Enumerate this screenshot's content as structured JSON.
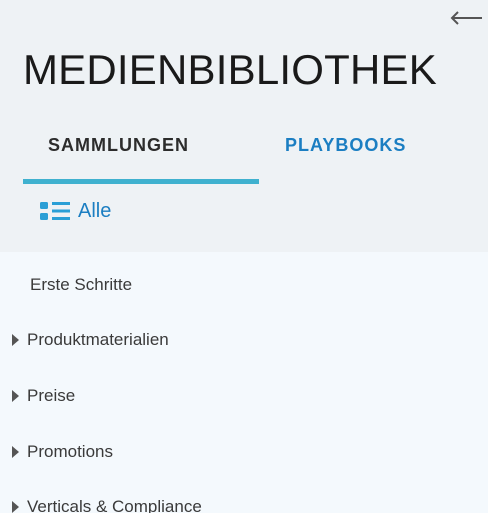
{
  "header": {
    "back_icon": "arrow-left-icon",
    "title": "MEDIENBIBLIOTHEK"
  },
  "tabs": [
    {
      "label": "SAMMLUNGEN",
      "active": true
    },
    {
      "label": "PLAYBOOKS",
      "active": false
    }
  ],
  "filter": {
    "icon": "list-icon",
    "label": "Alle"
  },
  "collections": [
    {
      "label": "Erste Schritte",
      "expandable": false
    },
    {
      "label": "Produktmaterialien",
      "expandable": true
    },
    {
      "label": "Preise",
      "expandable": true
    },
    {
      "label": "Promotions",
      "expandable": true
    },
    {
      "label": "Verticals & Compliance",
      "expandable": true
    }
  ],
  "colors": {
    "accent": "#1b7ec2",
    "tab_underline": "#3fb1cf",
    "header_bg": "#eef2f5",
    "list_bg": "#f4f9fd",
    "title": "#1a1a1a"
  }
}
